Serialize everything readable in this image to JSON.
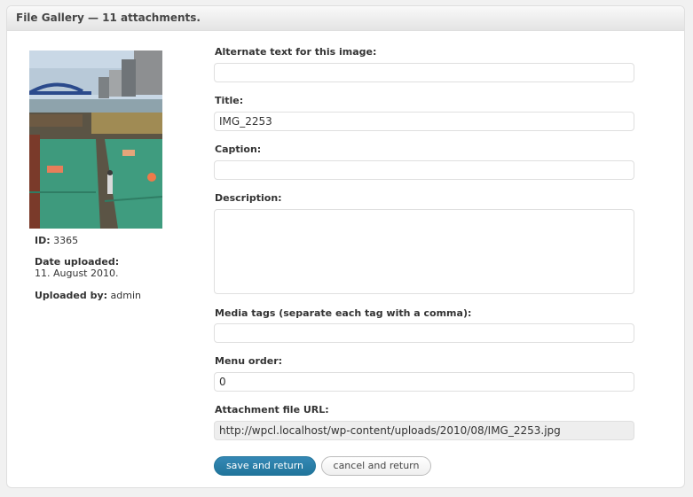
{
  "header": {
    "title": "File Gallery — 11 attachments."
  },
  "attachment": {
    "id_label": "ID:",
    "id_value": "3365",
    "date_label": "Date uploaded:",
    "date_value": "11. August 2010.",
    "uploader_label": "Uploaded by:",
    "uploader_value": "admin"
  },
  "form": {
    "alt_label": "Alternate text for this image:",
    "alt_value": "",
    "title_label": "Title:",
    "title_value": "IMG_2253",
    "caption_label": "Caption:",
    "caption_value": "",
    "description_label": "Description:",
    "description_value": "",
    "tags_label": "Media tags (separate each tag with a comma):",
    "tags_value": "",
    "order_label": "Menu order:",
    "order_value": "0",
    "url_label": "Attachment file URL:",
    "url_value": "http://wpcl.localhost/wp-content/uploads/2010/08/IMG_2253.jpg"
  },
  "buttons": {
    "save_label": "save and return",
    "cancel_label": "cancel and return"
  },
  "colors": {
    "primary": "#21759b",
    "border": "#dfdfdf",
    "header_bg": "#e4e4e4"
  }
}
